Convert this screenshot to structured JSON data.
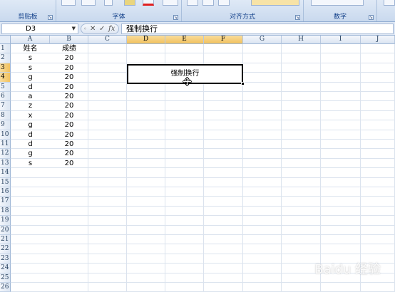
{
  "ribbon": {
    "groups": [
      "剪贴板",
      "字体",
      "对齐方式",
      "数字"
    ]
  },
  "formula_bar": {
    "name_box": "D3",
    "fx_label": "fx",
    "content": "强制换行"
  },
  "columns": [
    "A",
    "B",
    "C",
    "D",
    "E",
    "F",
    "G",
    "H",
    "I",
    "J"
  ],
  "rows": [
    "1",
    "2",
    "3",
    "4",
    "5",
    "6",
    "7",
    "8",
    "9",
    "10",
    "11",
    "12",
    "13",
    "14",
    "15",
    "16",
    "17",
    "18",
    "19",
    "20",
    "21",
    "22",
    "23",
    "24",
    "25",
    "26"
  ],
  "table": {
    "headers": [
      "姓名",
      "成绩"
    ],
    "rows": [
      [
        "s",
        "20"
      ],
      [
        "s",
        "20"
      ],
      [
        "g",
        "20"
      ],
      [
        "d",
        "20"
      ],
      [
        "a",
        "20"
      ],
      [
        "z",
        "20"
      ],
      [
        "x",
        "20"
      ],
      [
        "g",
        "20"
      ],
      [
        "d",
        "20"
      ],
      [
        "d",
        "20"
      ],
      [
        "g",
        "20"
      ],
      [
        "s",
        "20"
      ]
    ]
  },
  "active_cell": {
    "ref": "D3",
    "text": "强制换行"
  },
  "watermark": "Baidu 经验",
  "colors": {
    "ribbon": "#c9d9ee",
    "selected_header": "#f1c15f",
    "grid_line": "#dbe3ee"
  }
}
